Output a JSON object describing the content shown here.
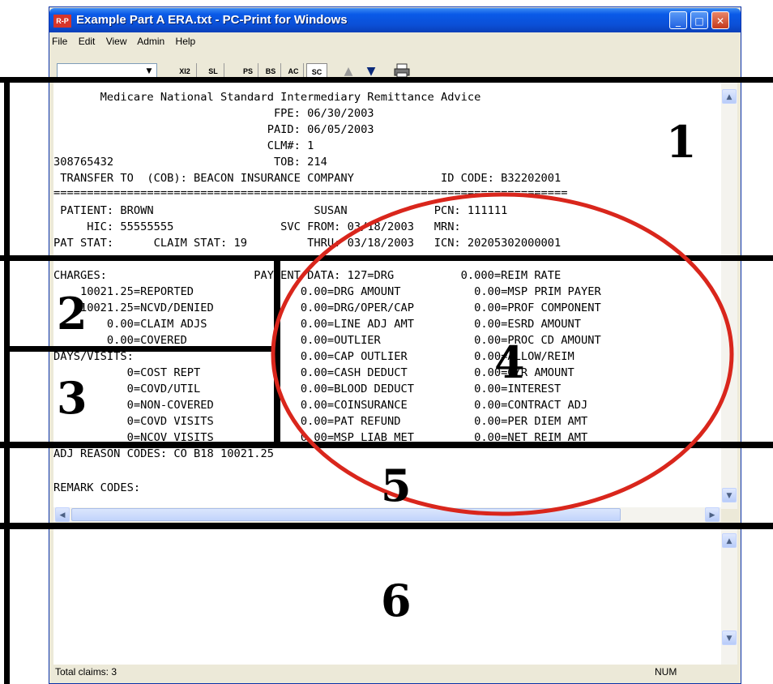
{
  "window": {
    "app_icon_text": "R-P",
    "title": "Example Part A ERA.txt - PC-Print for Windows",
    "minimize_glyph": "_",
    "maximize_glyph": "□",
    "close_glyph": "✕"
  },
  "menu": [
    "File",
    "Edit",
    "View",
    "Admin",
    "Help"
  ],
  "toolbar": {
    "combo_value": "",
    "buttons": [
      "XI2",
      "SL",
      "PS",
      "BS",
      "AC",
      "SC"
    ],
    "pressed": "SC",
    "icons": [
      "up-arrow-icon",
      "down-arrow-icon",
      "printer-icon"
    ]
  },
  "document": {
    "lines": [
      "       Medicare National Standard Intermediary Remittance Advice",
      "                                 FPE: 06/30/2003",
      "                                PAID: 06/05/2003",
      "                                CLM#: 1",
      "308765432                        TOB: 214",
      " TRANSFER TO  (COB): BEACON INSURANCE COMPANY             ID CODE: B32202001",
      "=============================================================================",
      " PATIENT: BROWN                        SUSAN             PCN: 111111",
      "     HIC: 55555555                SVC FROM: 03/18/2003   MRN:",
      "PAT STAT:      CLAIM STAT: 19         THRU: 03/18/2003   ICN: 20205302000001",
      "",
      "CHARGES:                      PAYMENT DATA: 127=DRG          0.000=REIM RATE",
      "    10021.25=REPORTED                0.00=DRG AMOUNT           0.00=MSP PRIM PAYER",
      "    10021.25=NCVD/DENIED             0.00=DRG/OPER/CAP         0.00=PROF COMPONENT",
      "        0.00=CLAIM ADJS              0.00=LINE ADJ AMT         0.00=ESRD AMOUNT",
      "        0.00=COVERED                 0.00=OUTLIER              0.00=PROC CD AMOUNT",
      "DAYS/VISITS:                         0.00=CAP OUTLIER          0.00=ALLOW/REIM",
      "           0=COST REPT               0.00=CASH DEDUCT          0.00=G/R AMOUNT",
      "           0=COVD/UTIL               0.00=BLOOD DEDUCT         0.00=INTEREST",
      "           0=NON-COVERED             0.00=COINSURANCE          0.00=CONTRACT ADJ",
      "           0=COVD VISITS             0.00=PAT REFUND           0.00=PER DIEM AMT",
      "           0=NCOV VISITS             0.00=MSP LIAB MET         0.00=NET REIM AMT",
      "ADJ REASON CODES: CO B18 10021.25",
      "",
      "REMARK CODES:"
    ]
  },
  "status": {
    "total": "Total claims: 3",
    "num": "NUM"
  },
  "overlay": {
    "labels": [
      "1",
      "2",
      "3",
      "4",
      "5",
      "6"
    ],
    "ellipse_color": "#d9261c"
  }
}
